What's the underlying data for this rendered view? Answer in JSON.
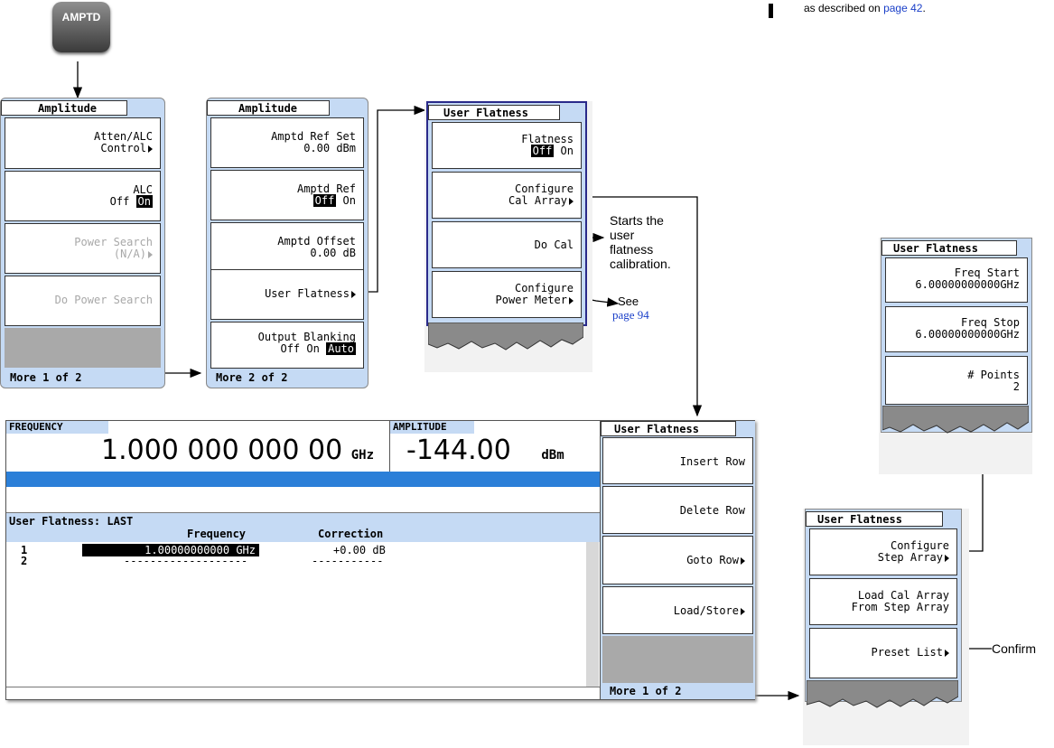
{
  "top_note": "as described on",
  "top_note_link": "page 42",
  "amptd_key": "AMPTD",
  "menu1": {
    "title": "Amplitude",
    "keys": [
      {
        "line1": "Atten/ALC",
        "line2": "Control"
      },
      {
        "line1": "ALC",
        "off": "Off",
        "on": "On"
      },
      {
        "line1": "Power Search",
        "line2": "(N/A)"
      },
      {
        "line1": "Do Power Search"
      }
    ],
    "more": "More 1 of 2"
  },
  "menu2": {
    "title": "Amplitude",
    "keys": [
      {
        "line1": "Amptd Ref Set",
        "line2": "0.00 dBm"
      },
      {
        "line1": "Amptd Ref",
        "off": "Off",
        "on": "On"
      },
      {
        "line1": "Amptd Offset",
        "line2": "0.00 dB"
      },
      {
        "line1": "User Flatness"
      },
      {
        "line1": "Output Blanking",
        "off": "Off",
        "on": "On",
        "auto": "Auto"
      }
    ],
    "more": "More 2 of 2"
  },
  "menu3": {
    "title": "User Flatness",
    "keys": [
      {
        "line1": "Flatness",
        "off": "Off",
        "on": "On"
      },
      {
        "line1": "Configure",
        "line2": "Cal Array"
      },
      {
        "line1": "Do Cal"
      },
      {
        "line1": "Configure",
        "line2": "Power Meter"
      }
    ]
  },
  "callouts": {
    "do_cal_1": "Starts the",
    "do_cal_2": "user",
    "do_cal_3": "flatness",
    "do_cal_4": "calibration.",
    "see": "See",
    "see_link": "page 94",
    "confirm": "Confirm"
  },
  "menu_right_top": {
    "title": "User Flatness",
    "keys": [
      {
        "line1": "Freq Start",
        "line2": "6.00000000000GHz"
      },
      {
        "line1": "Freq Stop",
        "line2": "6.00000000000GHz"
      },
      {
        "line1": "# Points",
        "line2": "2"
      }
    ]
  },
  "menu_right_bottom": {
    "title": "User Flatness",
    "keys": [
      {
        "line1": "Configure",
        "line2": "Step Array"
      },
      {
        "line1": "Load Cal Array",
        "line2": "From Step Array"
      },
      {
        "line1": "Preset List"
      }
    ]
  },
  "screen": {
    "freq_label": "FREQUENCY",
    "freq_value": "1.000 000 000 00",
    "freq_unit": "GHz",
    "amp_label": "AMPLITUDE",
    "amp_value": "-144.00",
    "amp_unit": "dBm",
    "table_title": "User Flatness: LAST",
    "col_freq": "Frequency",
    "col_corr": "Correction",
    "rows": [
      {
        "num": "1",
        "freq": "1.00000000000 GHz",
        "corr": "+0.00 dB"
      },
      {
        "num": "2",
        "freq": "-------------------",
        "corr": "-----------"
      }
    ],
    "menu_title": "User Flatness",
    "keys": [
      "Insert Row",
      "Delete Row",
      "Goto Row",
      "Load/Store"
    ],
    "more": "More 1 of 2"
  },
  "colors": {
    "accent": "#c5daf4",
    "bar": "#2b7fd8",
    "panel_gray": "#a9a9a9"
  }
}
